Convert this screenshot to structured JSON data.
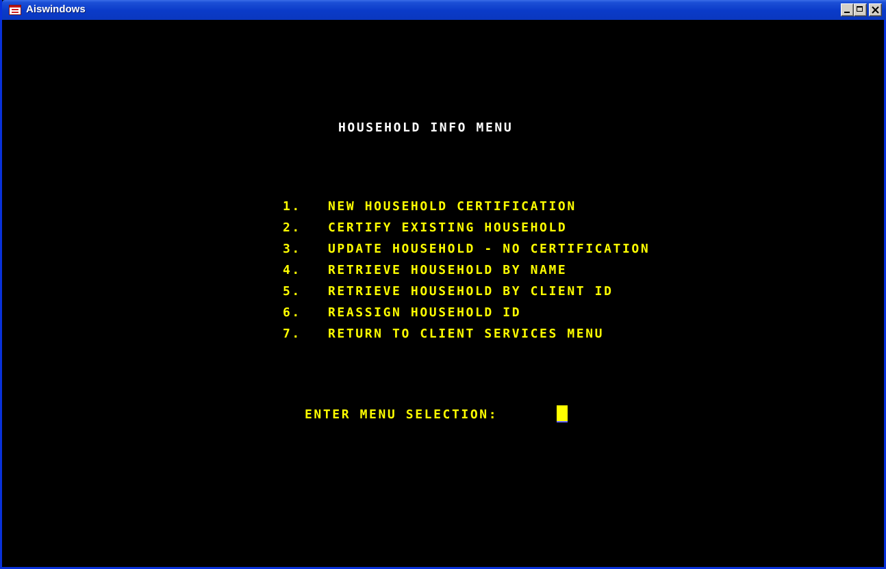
{
  "window": {
    "title": "Aiswindows",
    "icon": "app-window-icon",
    "controls": [
      "minimize-icon",
      "maximize-icon",
      "close-icon"
    ]
  },
  "screen": {
    "heading": "HOUSEHOLD INFO MENU",
    "menu": [
      {
        "num": "1.",
        "label": "NEW HOUSEHOLD CERTIFICATION"
      },
      {
        "num": "2.",
        "label": "CERTIFY EXISTING HOUSEHOLD"
      },
      {
        "num": "3.",
        "label": "UPDATE HOUSEHOLD - NO CERTIFICATION"
      },
      {
        "num": "4.",
        "label": "RETRIEVE HOUSEHOLD BY NAME"
      },
      {
        "num": "5.",
        "label": "RETRIEVE HOUSEHOLD BY CLIENT ID"
      },
      {
        "num": "6.",
        "label": "REASSIGN HOUSEHOLD ID"
      },
      {
        "num": "7.",
        "label": "RETURN TO CLIENT SERVICES MENU"
      }
    ],
    "prompt": "ENTER MENU SELECTION:",
    "input_value": ""
  },
  "colors": {
    "background": "#000000",
    "heading": "#ffffff",
    "menu_text": "#ffff00",
    "cursor": "#ffff00",
    "titlebar": "#0a3ac8"
  }
}
